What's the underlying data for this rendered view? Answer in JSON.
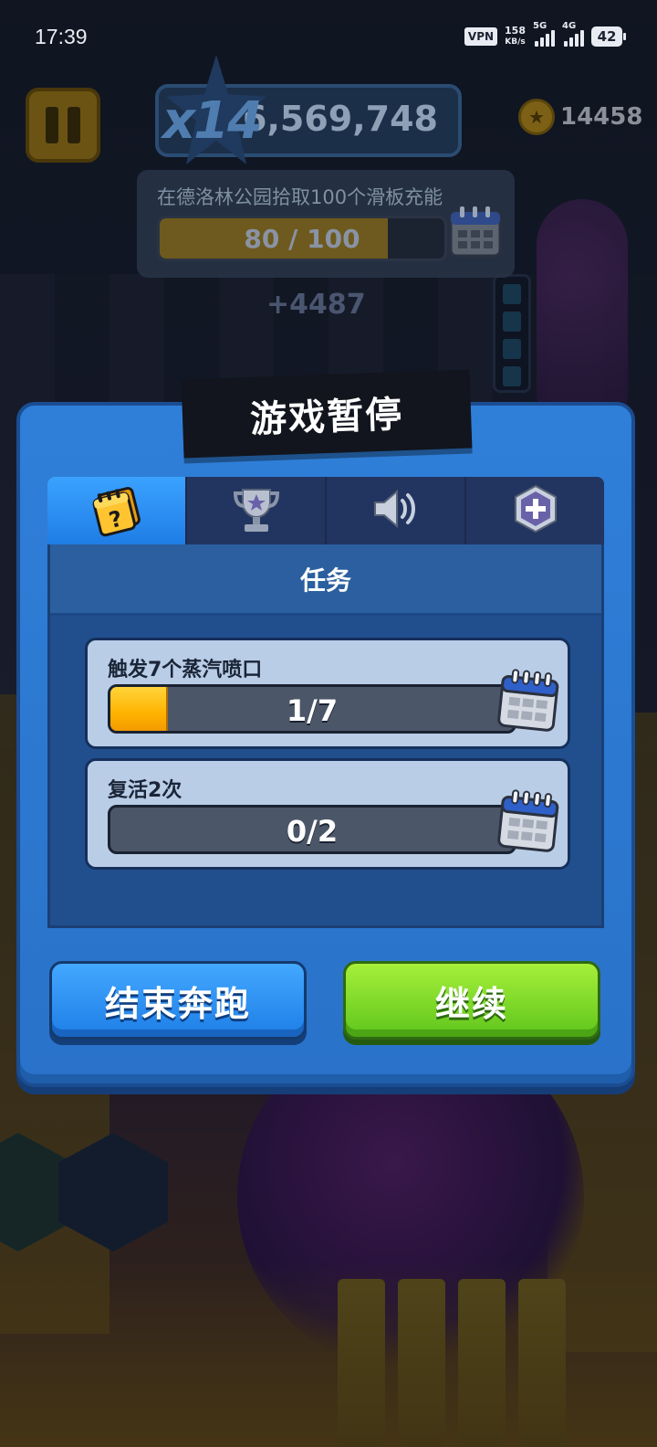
{
  "status_bar": {
    "time": "17:39",
    "vpn": "VPN",
    "net_speed_value": "158",
    "net_speed_unit": "KB/s",
    "signal1_tag": "5G",
    "signal2_tag": "4G",
    "battery": "42"
  },
  "hud": {
    "multiplier": "x14",
    "score": "6,569,748",
    "coins": "14458",
    "mission_text": "在德洛林公园拾取100个滑板充能",
    "mission_progress": "80 / 100",
    "mission_progress_fraction": 0.8,
    "bonus": "+4487"
  },
  "panel": {
    "title": "游戏暂停",
    "tabs": [
      {
        "name": "missions",
        "icon": "mission-cards-icon",
        "active": true
      },
      {
        "name": "trophies",
        "icon": "trophy-icon",
        "active": false
      },
      {
        "name": "sound",
        "icon": "speaker-icon",
        "active": false
      },
      {
        "name": "extras",
        "icon": "plus-hexagon-icon",
        "active": false
      }
    ],
    "section_title": "任务",
    "missions": [
      {
        "label": "触发7个蒸汽喷口",
        "progress": "1/7",
        "fraction": 0.142857
      },
      {
        "label": "复活2次",
        "progress": "0/2",
        "fraction": 0
      }
    ],
    "buttons": {
      "end_run": "结束奔跑",
      "continue": "继续"
    }
  },
  "colors": {
    "panel_blue": "#2f7fd9",
    "end_button": "#1e7ee6",
    "continue_button": "#5fc51c",
    "progress_fill": "#ffb300"
  }
}
